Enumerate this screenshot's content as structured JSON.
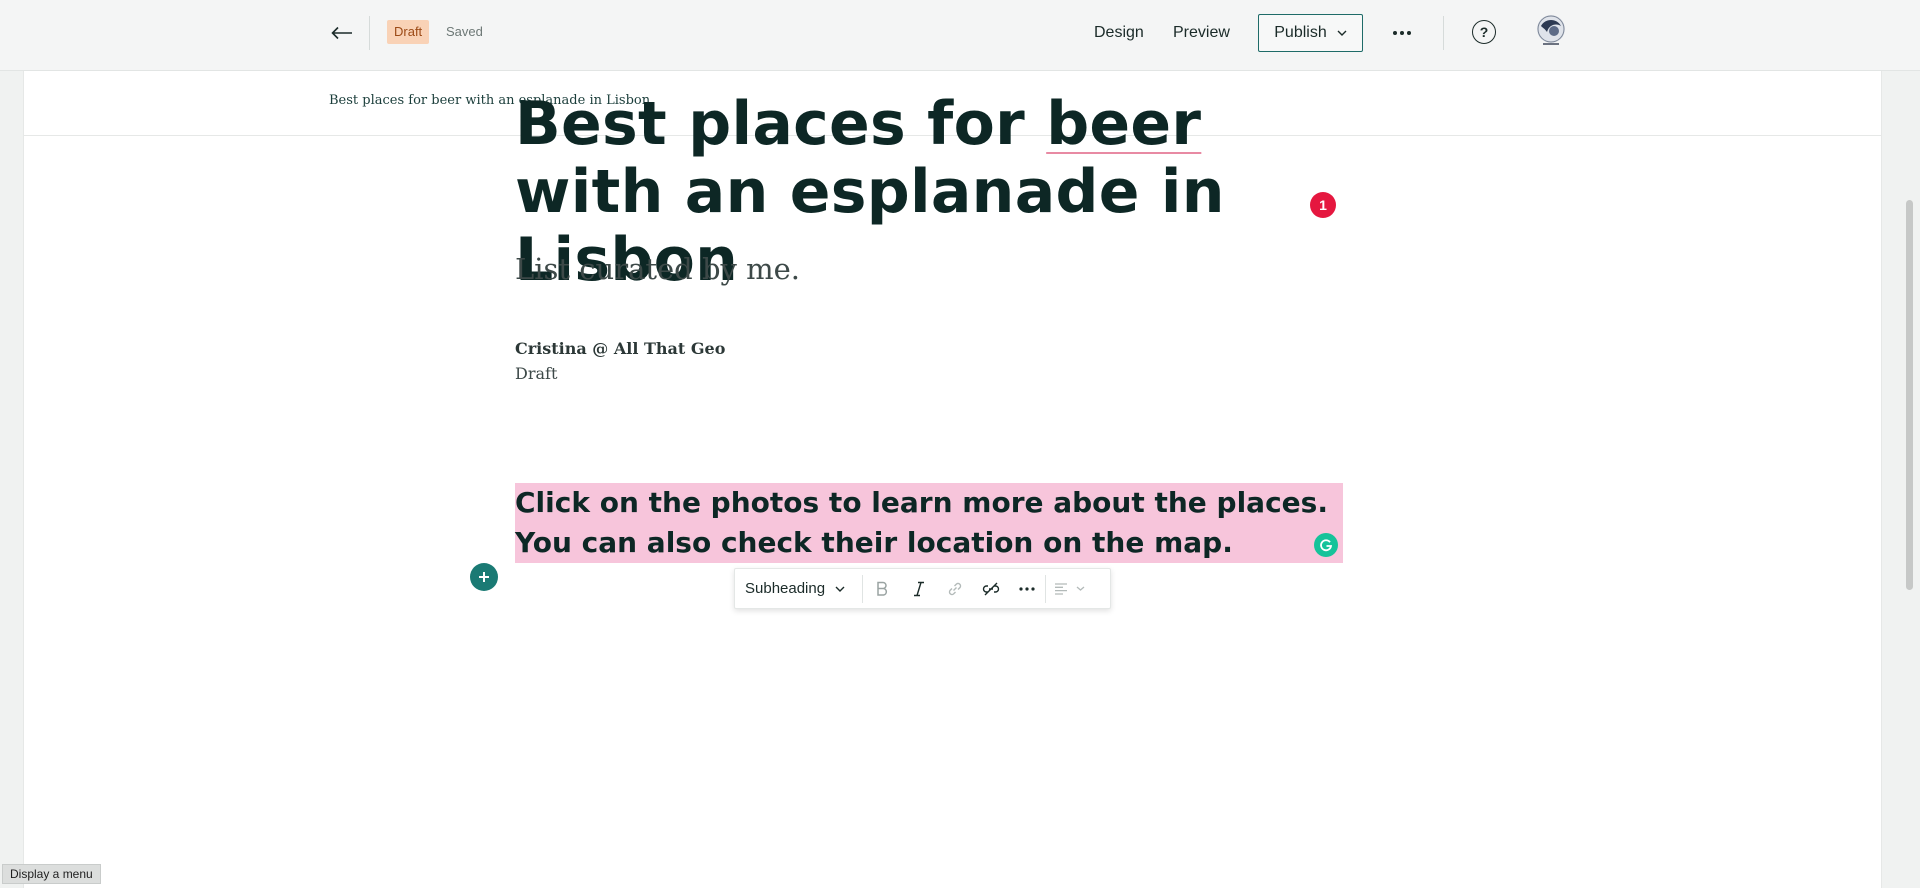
{
  "header": {
    "back_icon": "arrow-left-icon",
    "status_pill": "Draft",
    "save_status": "Saved",
    "design_label": "Design",
    "preview_label": "Preview",
    "publish_label": "Publish",
    "more_icon": "ellipsis-icon",
    "help_icon": "question-circle-icon",
    "help_symbol": "?",
    "avatar_icon": "user-avatar"
  },
  "breadcrumb": {
    "text": "Best places for beer with an esplanade in Lisbon"
  },
  "story": {
    "title_part1": "Best places for ",
    "title_underlined": "beer",
    "title_part2": " with an esplanade in Lisbon",
    "issue_count": "1",
    "subtitle": "List curated by me.",
    "author": "Cristina @ All That Geo",
    "status": "Draft",
    "selected_block": "Click on the photos to learn more about the places. You can also check their location on the map."
  },
  "format_toolbar": {
    "style_label": "Subheading",
    "buttons": [
      "bold-icon",
      "italic-icon",
      "link-icon",
      "unlink-icon",
      "more-icon",
      "align-icon"
    ]
  },
  "tooltip": {
    "text": "Display a menu"
  },
  "colors": {
    "accent": "#1a7a74",
    "highlight": "#f7c5db",
    "badge": "#e5173f",
    "grammarly": "#15c39a",
    "draft_pill": "#f9d2b6"
  }
}
